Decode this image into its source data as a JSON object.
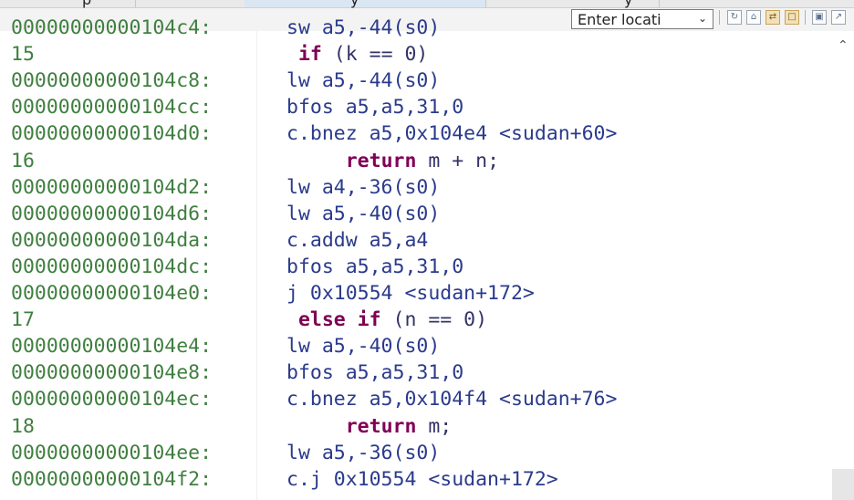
{
  "tabs": [
    {
      "label": "p"
    },
    {
      "label": "y"
    },
    {
      "label": "y"
    }
  ],
  "location": {
    "value": "Enter locati"
  },
  "toolbar": [
    {
      "icon": "goto-pc-icon"
    },
    {
      "icon": "home-icon"
    },
    {
      "icon": "link-with-editor-icon"
    },
    {
      "icon": "show-source-icon"
    },
    {
      "icon": "open-new-view-icon"
    },
    {
      "icon": "pin-icon"
    }
  ],
  "colors": {
    "address": "#3f7f3f",
    "instruction": "#2a3a8c",
    "keyword": "#7f0055"
  },
  "lines": [
    {
      "kind": "asm",
      "addr": "00000000000104c4:",
      "text": "sw a5,-44(s0)"
    },
    {
      "kind": "src",
      "num": "15",
      "pre": " ",
      "kw": "if",
      "post": " (k == 0)"
    },
    {
      "kind": "asm",
      "addr": "00000000000104c8:",
      "text": "lw a5,-44(s0)"
    },
    {
      "kind": "asm",
      "addr": "00000000000104cc:",
      "text": "bfos a5,a5,31,0"
    },
    {
      "kind": "asm",
      "addr": "00000000000104d0:",
      "text": "c.bnez a5,0x104e4 <sudan+60>"
    },
    {
      "kind": "src",
      "num": "16",
      "pre": "     ",
      "kw": "return",
      "post": " m + n;"
    },
    {
      "kind": "asm",
      "addr": "00000000000104d2:",
      "text": "lw a4,-36(s0)"
    },
    {
      "kind": "asm",
      "addr": "00000000000104d6:",
      "text": "lw a5,-40(s0)"
    },
    {
      "kind": "asm",
      "addr": "00000000000104da:",
      "text": "c.addw a5,a4"
    },
    {
      "kind": "asm",
      "addr": "00000000000104dc:",
      "text": "bfos a5,a5,31,0"
    },
    {
      "kind": "asm",
      "addr": "00000000000104e0:",
      "text": "j 0x10554 <sudan+172>"
    },
    {
      "kind": "src",
      "num": "17",
      "pre": " ",
      "kw": "else if",
      "post": " (n == 0)"
    },
    {
      "kind": "asm",
      "addr": "00000000000104e4:",
      "text": "lw a5,-40(s0)"
    },
    {
      "kind": "asm",
      "addr": "00000000000104e8:",
      "text": "bfos a5,a5,31,0"
    },
    {
      "kind": "asm",
      "addr": "00000000000104ec:",
      "text": "c.bnez a5,0x104f4 <sudan+76>"
    },
    {
      "kind": "src",
      "num": "18",
      "pre": "     ",
      "kw": "return",
      "post": " m;"
    },
    {
      "kind": "asm",
      "addr": "00000000000104ee:",
      "text": "lw a5,-36(s0)"
    },
    {
      "kind": "asm",
      "addr": "00000000000104f2:",
      "text": "c.j 0x10554 <sudan+172>"
    }
  ]
}
